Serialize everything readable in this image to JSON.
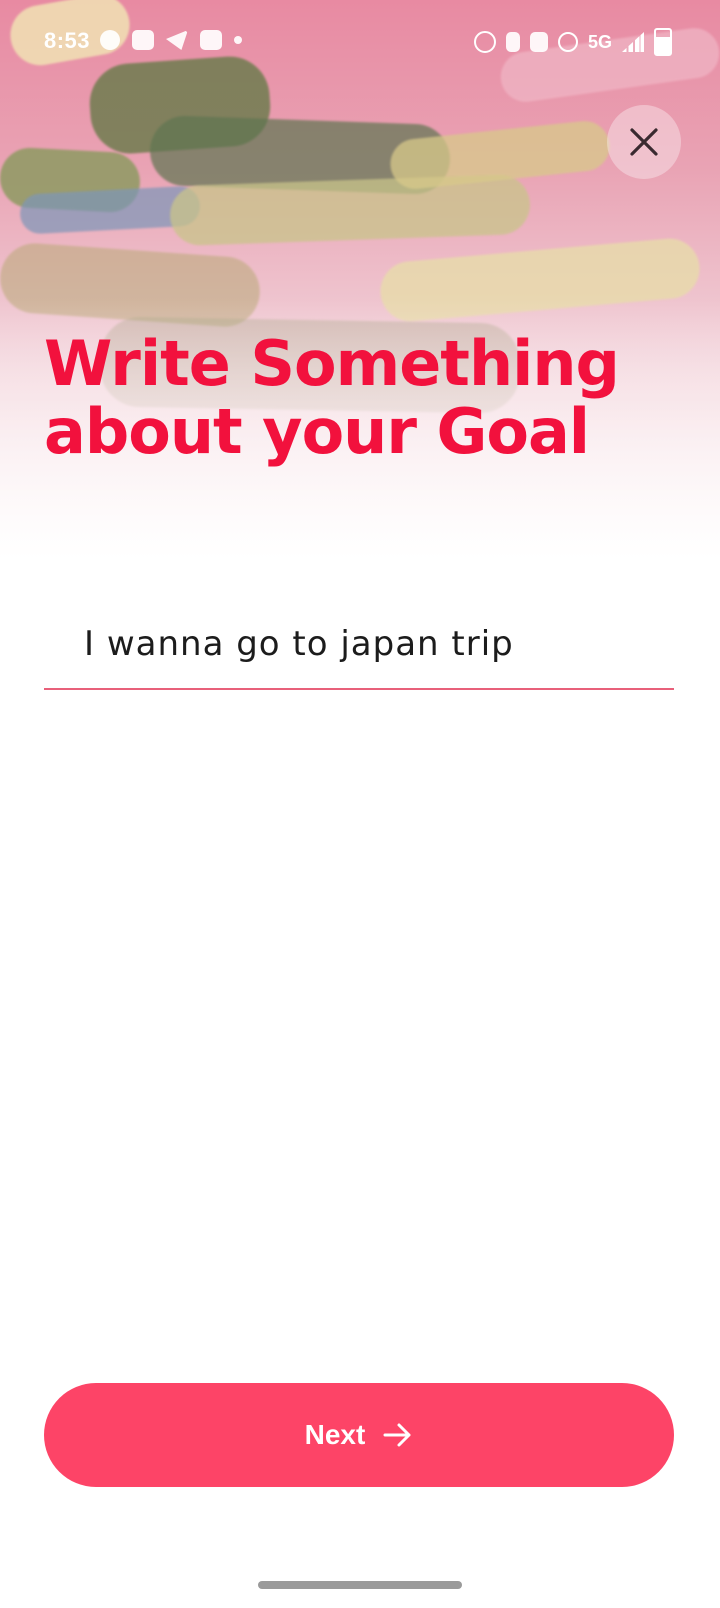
{
  "status_bar": {
    "time": "8:53",
    "network": "5G"
  },
  "header": {
    "close_icon": "close-icon"
  },
  "main": {
    "title_line1": "Write Something",
    "title_line2": "about your Goal",
    "goal_value": "I wanna go to japan trip",
    "title_color": "#f2113d",
    "underline_color": "#e8607a"
  },
  "footer": {
    "next_label": "Next",
    "next_icon": "arrow-right-icon",
    "button_color": "#fd4467"
  }
}
